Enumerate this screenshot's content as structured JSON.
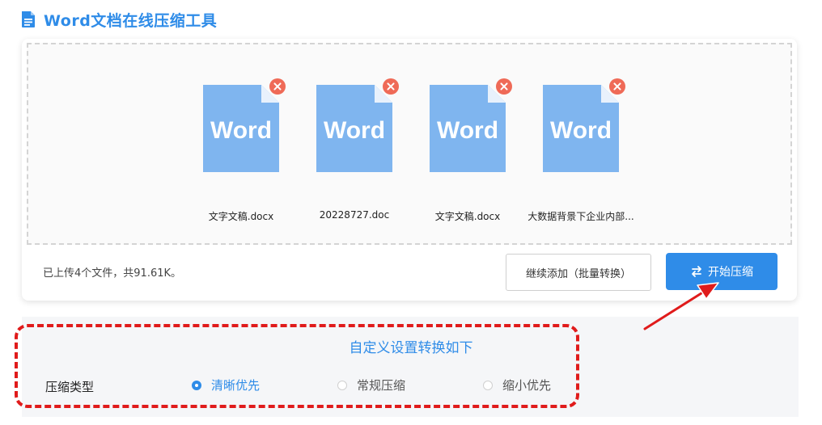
{
  "header": {
    "title": "Word文档在线压缩工具",
    "icon": "document-icon"
  },
  "files": [
    {
      "name": "文字文稿.docx",
      "icon_text": "Word"
    },
    {
      "name": "20228727.doc",
      "icon_text": "Word"
    },
    {
      "name": "文字文稿.docx",
      "icon_text": "Word"
    },
    {
      "name": "大数据背景下企业内部...",
      "icon_text": "Word"
    }
  ],
  "upload": {
    "summary": "已上传4个文件，共91.61K。",
    "continue_label": "继续添加（批量转换）",
    "start_label": "开始压缩"
  },
  "settings": {
    "title": "自定义设置转换如下",
    "type_label": "压缩类型",
    "options": [
      {
        "label": "清晰优先",
        "selected": true
      },
      {
        "label": "常规压缩",
        "selected": false
      },
      {
        "label": "缩小优先",
        "selected": false
      }
    ]
  },
  "colors": {
    "accent": "#2f8ce8",
    "doc_icon": "#7fb5ef",
    "remove": "#ef6a57",
    "annotation": "#e01b1b"
  }
}
